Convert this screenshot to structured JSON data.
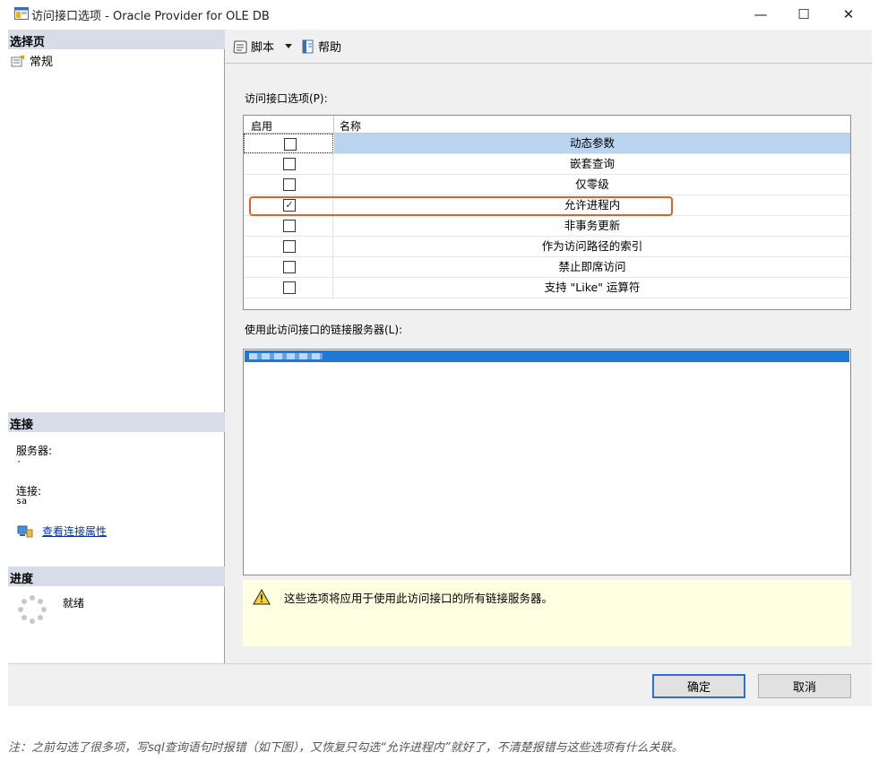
{
  "window": {
    "title": "访问接口选项 - Oracle Provider for OLE DB",
    "minimize_glyph": "—",
    "maximize_glyph": "☐",
    "close_glyph": "✕"
  },
  "left_panel": {
    "select_page_header": "选择页",
    "pages": [
      {
        "label": "常规",
        "icon": "properties-page-icon"
      }
    ],
    "connection_header": "连接",
    "server_label": "服务器:",
    "server_value": "·",
    "connection_label": "连接:",
    "connection_value": "sa",
    "view_connection_link": "查看连接属性",
    "progress_header": "进度",
    "progress_status": "就绪"
  },
  "toolbar": {
    "script_label": "脚本",
    "help_label": "帮助"
  },
  "provider_options": {
    "label": "访问接口选项(P):",
    "columns": [
      "启用",
      "名称"
    ],
    "rows": [
      {
        "name": "动态参数",
        "checked": false,
        "selected": true
      },
      {
        "name": "嵌套查询",
        "checked": false,
        "selected": false
      },
      {
        "name": "仅零级",
        "checked": false,
        "selected": false
      },
      {
        "name": "允许进程内",
        "checked": true,
        "selected": false
      },
      {
        "name": "非事务更新",
        "checked": false,
        "selected": false
      },
      {
        "name": "作为访问路径的索引",
        "checked": false,
        "selected": false
      },
      {
        "name": "禁止即席访问",
        "checked": false,
        "selected": false
      },
      {
        "name": "支持 \"Like\" 运算符",
        "checked": false,
        "selected": false
      }
    ],
    "highlight_color": "#e0602a",
    "selected_row_color": "#b8d4ee"
  },
  "linked_servers": {
    "label": "使用此访问接口的链接服务器(L):",
    "selection_color": "#1e78d6"
  },
  "warning": {
    "text": "这些选项将应用于使用此访问接口的所有链接服务器。",
    "icon": "warning-icon"
  },
  "buttons": {
    "ok_label": "确定",
    "cancel_label": "取消"
  },
  "footnote": "注：之前勾选了很多项，写sql查询语句时报错（如下图），又恢复只勾选“允许进程内”就好了，不清楚报错与这些选项有什么关联。"
}
